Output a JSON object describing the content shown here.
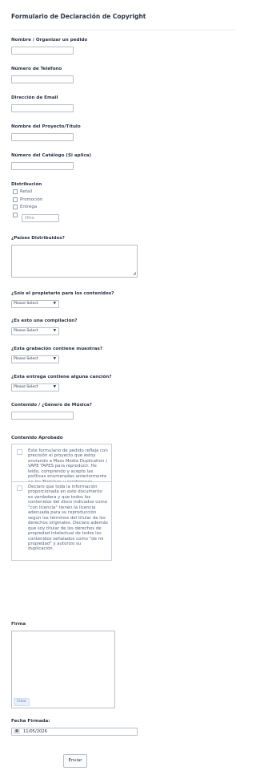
{
  "form": {
    "title": "Formulario de Declaración de Copyright",
    "name_label": "Nombre / Organizar un pedido",
    "phone_label": "Número de Teléfono",
    "email_label": "Dirección de Email",
    "project_label": "Nombre del Proyecto/Título",
    "catalog_label": "Número del Catálogo (Si aplica)",
    "distribution": {
      "label": "Distribución",
      "options": [
        "Retail",
        "Promoción",
        "Entrega"
      ],
      "other_placeholder": "Otro"
    },
    "countries_label": "¿Países Distribuidos?",
    "owner": {
      "label": "¿Sois el propietario para los contenidos?",
      "selected": "Please Select"
    },
    "compilation": {
      "label": "¿Es esto una compilación?",
      "selected": "Please Select"
    },
    "samples": {
      "label": "¿Esta grabación contiene muestras?",
      "selected": "Please Select"
    },
    "songs": {
      "label": "¿Esta entrega contiene alguna canción?",
      "selected": "Please Select"
    },
    "genre_label": "Contenido / ¿Género de Música?",
    "approved": {
      "label": "Contenido Aprobado",
      "item1": "Este formulario de pedido refleja con precisión el proyecto que estoy enviando a Mass Media Duplication / VAPE TAPES para reproducir. He leído, comprendo y acepto las políticas enumeradas anteriormente en los Términos y condiciones.",
      "item2": "Declaro que toda la información proporcionada en este documento es verdadera y que todos los contenidos del disco indicados como \"con licencia\" tienen la licencia adecuada para su reproducción según los términos del titular de los derechos originales. Declaro además que soy titular de los derechos de propiedad intelectual de todos los contenidos señalados como \"de mi propiedad\" y autorizo su duplicación."
    },
    "signature": {
      "label": "Firma",
      "clear": "Clear"
    },
    "date": {
      "label": "Fecha Firmada:",
      "value": "11/05/2026",
      "icon": "calendar-icon"
    },
    "submit": "Enviar"
  }
}
